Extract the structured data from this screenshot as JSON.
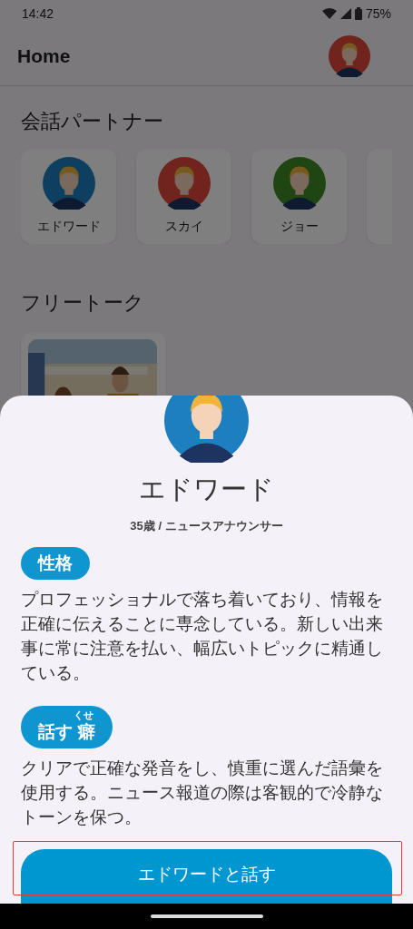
{
  "status_bar": {
    "time": "14:42",
    "battery": "75%"
  },
  "header": {
    "title": "Home"
  },
  "partners_section": {
    "title": "会話パートナー"
  },
  "partners": [
    {
      "name": "エドワード"
    },
    {
      "name": "スカイ"
    },
    {
      "name": "ジョー"
    }
  ],
  "free_talk_section": {
    "title": "フリートーク"
  },
  "sheet": {
    "name": "エドワード",
    "subtitle": "35歳 / ニュースアナウンサー",
    "sections": [
      {
        "tag": {
          "label": "性格"
        },
        "text": "プロフェッショナルで落ち着いており、情報を正確に伝えることに専念している。新しい出来事に常に注意を払い、幅広いトピックに精通している。"
      },
      {
        "tag": {
          "label": "話す",
          "ruby_base": "癖",
          "ruby": "くせ"
        },
        "text": "クリアで正確な発音をし、慎重に選んだ語彙を使用する。ニュース報道の際は客観的で冷静なトーンを保つ。"
      }
    ],
    "button": "エドワードと話す"
  }
}
